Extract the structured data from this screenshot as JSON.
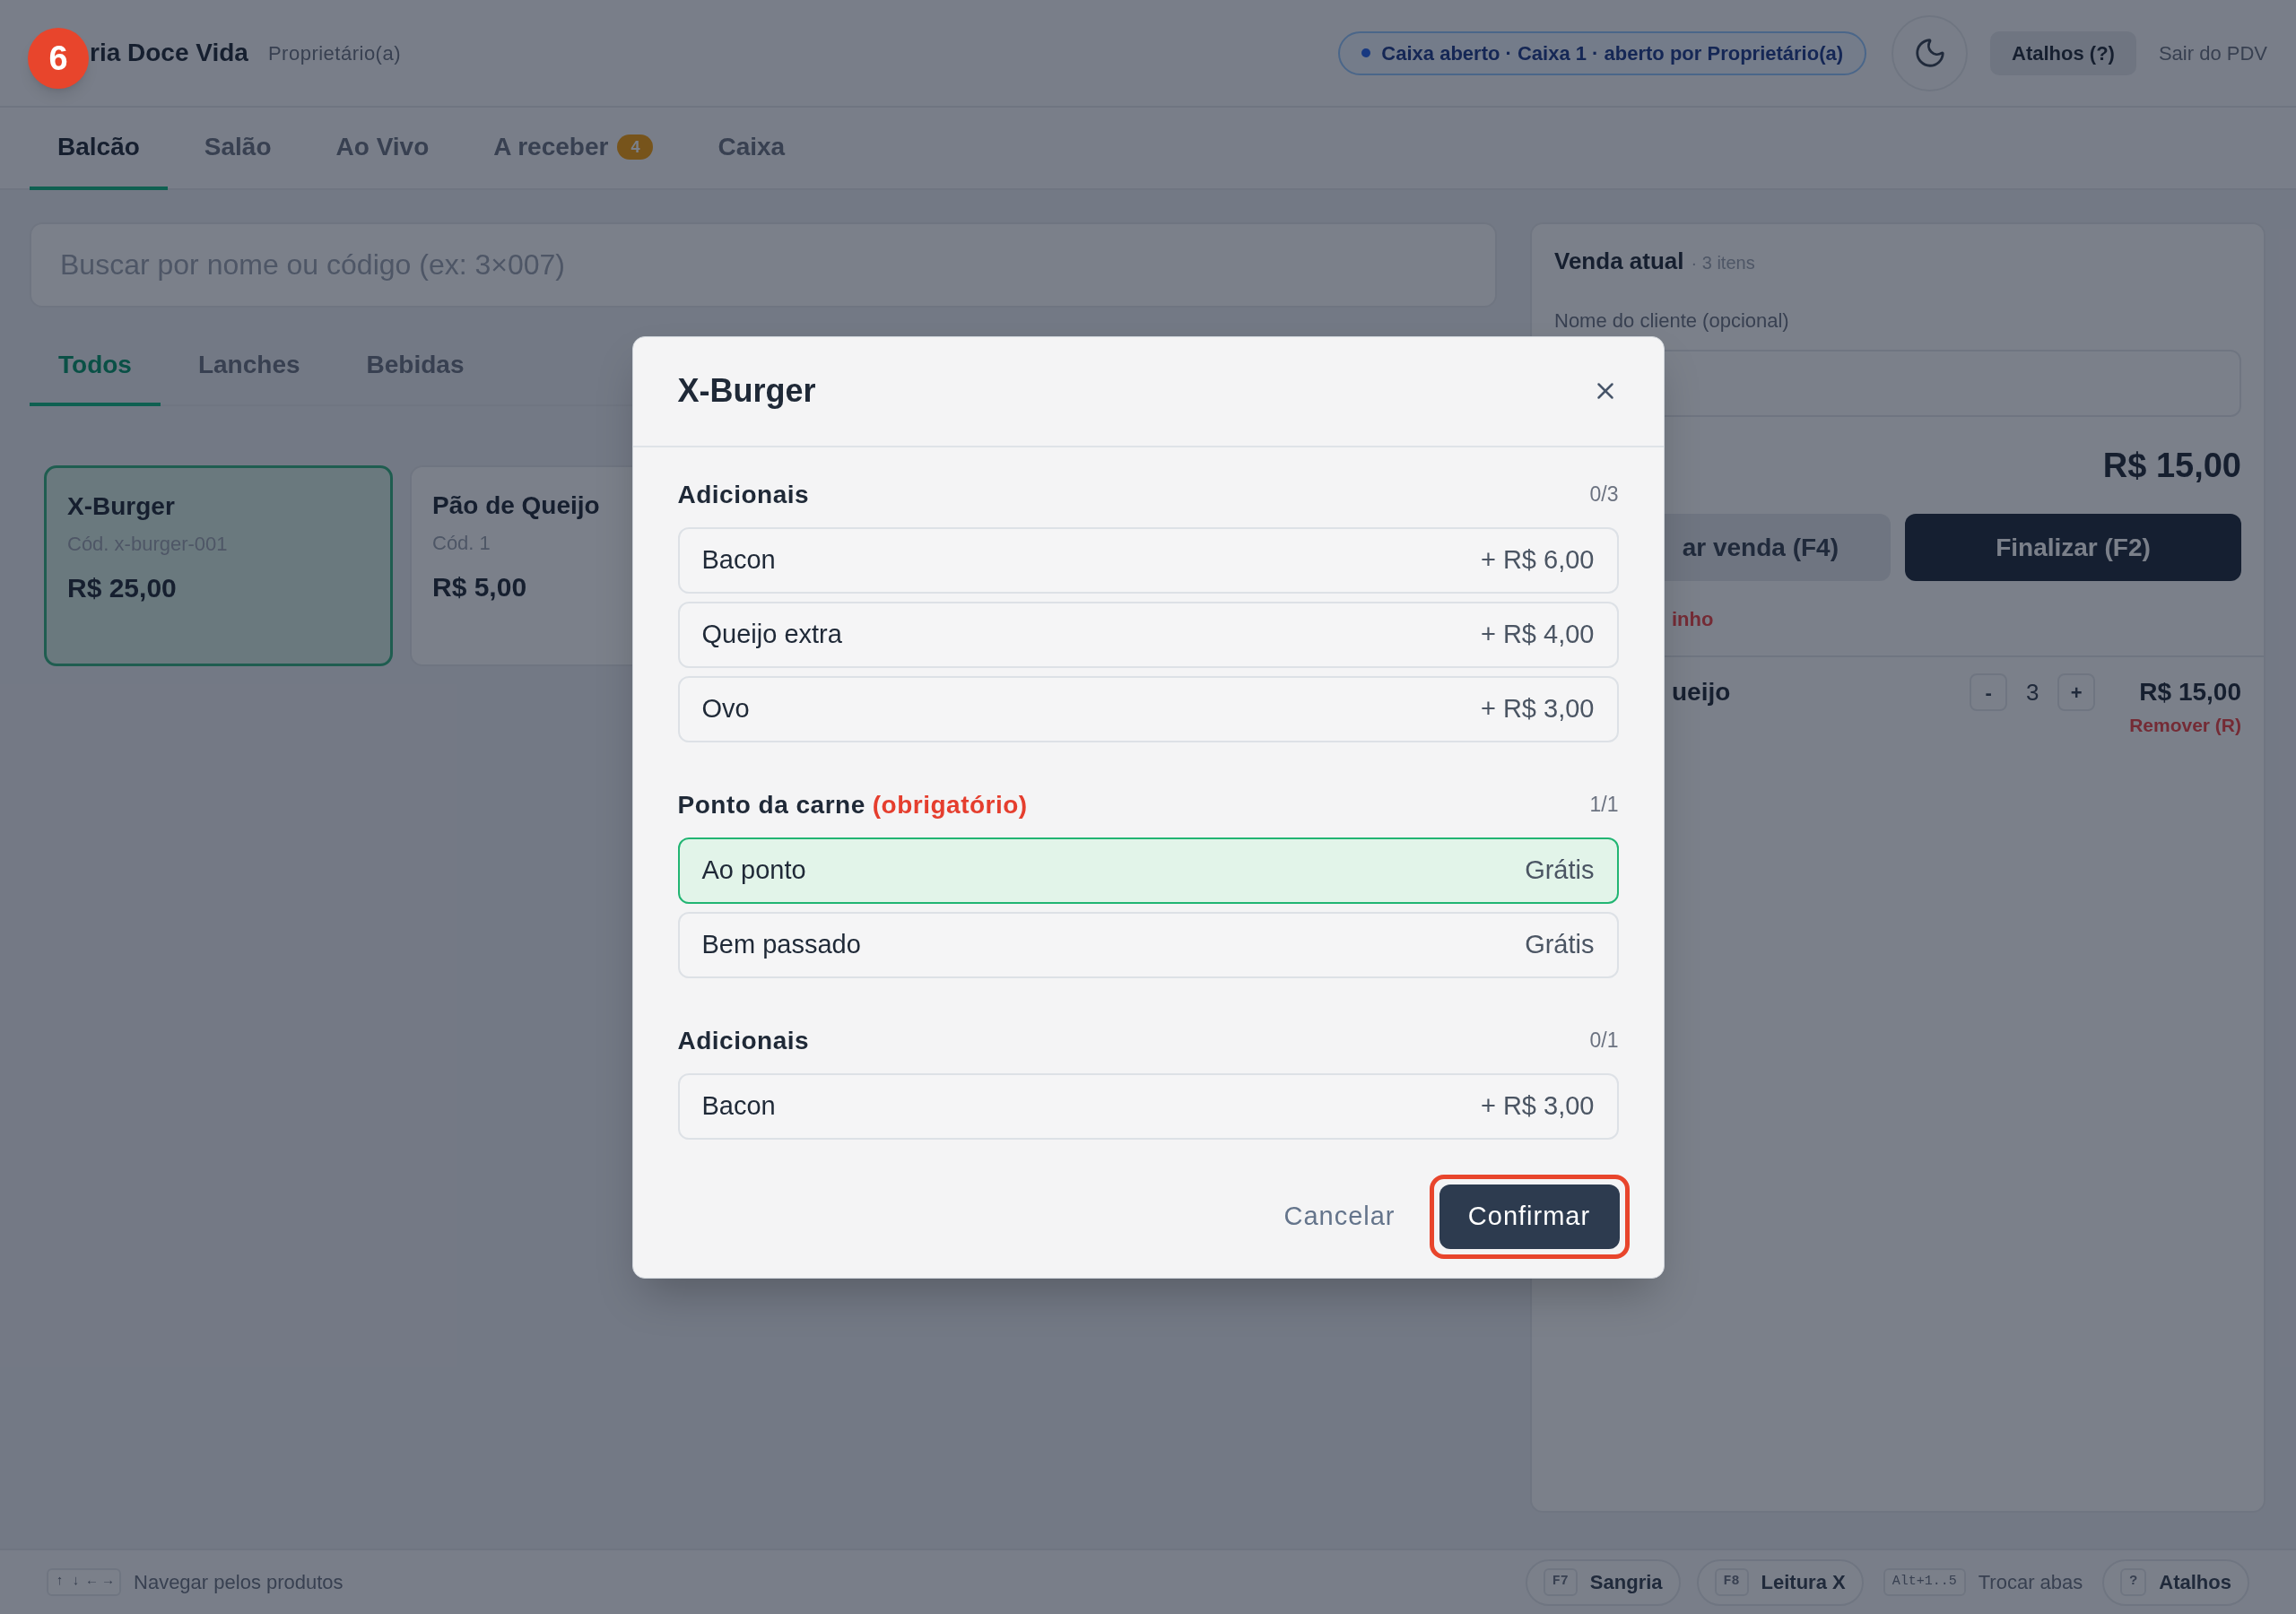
{
  "step_badge": "6",
  "header": {
    "store_name": "ria Doce Vida",
    "role": "Proprietário(a)",
    "status_pill": "Caixa aberto · Caixa 1 · aberto por Proprietário(a)",
    "shortcuts_button": "Atalhos (?)",
    "exit_link": "Sair do PDV"
  },
  "tabs": [
    {
      "label": "Balcão",
      "selected": true
    },
    {
      "label": "Salão",
      "selected": false
    },
    {
      "label": "Ao Vivo",
      "selected": false
    },
    {
      "label": "A receber",
      "selected": false,
      "badge": "4"
    },
    {
      "label": "Caixa",
      "selected": false
    }
  ],
  "search": {
    "placeholder": "Buscar por nome ou código (ex: 3×007)"
  },
  "categories": [
    {
      "label": "Todos",
      "selected": true
    },
    {
      "label": "Lanches",
      "selected": false
    },
    {
      "label": "Bebidas",
      "selected": false
    }
  ],
  "products": [
    {
      "name": "X-Burger",
      "code": "Cód. x-burger-001",
      "price": "R$ 25,00",
      "selected": true
    },
    {
      "name": "Pão de Queijo",
      "code": "Cód. 1",
      "price": "R$ 5,00",
      "selected": false
    }
  ],
  "sale": {
    "title": "Venda atual",
    "count": "· 3 itens",
    "customer_label": "Nome do cliente (opcional)",
    "total": "R$ 15,00",
    "secondary_button": "ar venda (F4)",
    "primary_button": "Finalizar (F2)",
    "clear_link": "inho",
    "items": [
      {
        "name": "ueijo",
        "decrement": "-",
        "quantity": "3",
        "increment": "+",
        "price": "R$ 15,00",
        "remove": "Remover (R)"
      }
    ]
  },
  "footer_bar": {
    "hint_keys": "↑ ↓ ← →",
    "hint": "Navegar pelos produtos",
    "shortcuts": [
      {
        "kind": "button",
        "key": "F7",
        "label": "Sangria"
      },
      {
        "kind": "button",
        "key": "F8",
        "label": "Leitura X"
      },
      {
        "kind": "plain",
        "key": "Alt+1..5",
        "label": "Trocar abas"
      },
      {
        "kind": "button",
        "key": "?",
        "label": "Atalhos"
      }
    ]
  },
  "dialog": {
    "title": "X-Burger",
    "groups": [
      {
        "title": "Adicionais",
        "counter": "0/3",
        "options": [
          {
            "name": "Bacon",
            "price": "+ R$ 6,00",
            "selected": false
          },
          {
            "name": "Queijo extra",
            "price": "+ R$ 4,00",
            "selected": false
          },
          {
            "name": "Ovo",
            "price": "+ R$ 3,00",
            "selected": false
          }
        ]
      },
      {
        "title": "Ponto da carne",
        "required_label": "(obrigatório)",
        "counter": "1/1",
        "options": [
          {
            "name": "Ao ponto",
            "price": "Grátis",
            "selected": true
          },
          {
            "name": "Bem passado",
            "price": "Grátis",
            "selected": false
          }
        ]
      },
      {
        "title": "Adicionais",
        "counter": "0/1",
        "options": [
          {
            "name": "Bacon",
            "price": "+ R$ 3,00",
            "selected": false
          }
        ]
      }
    ],
    "cancel": "Cancelar",
    "confirm": {
      "label": "Confirmar",
      "highlighted": true
    }
  }
}
